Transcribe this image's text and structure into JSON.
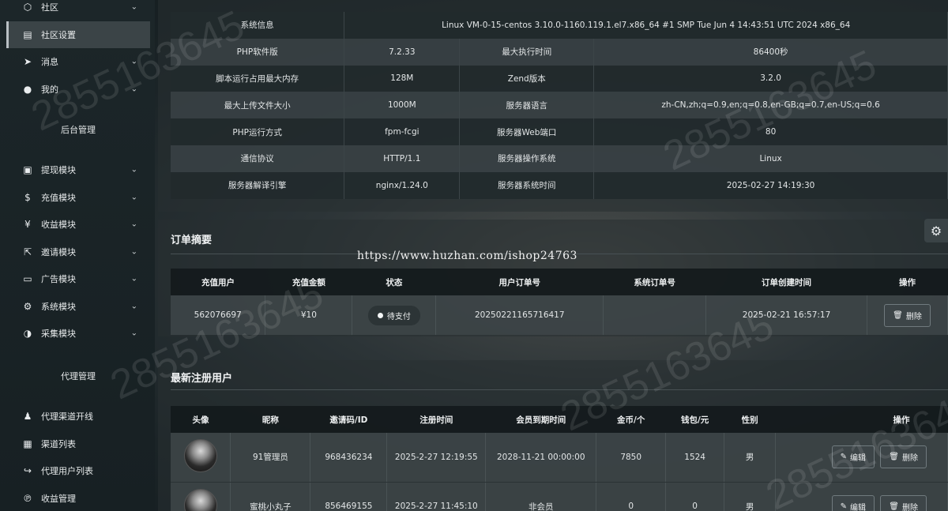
{
  "sidebar": {
    "top_items": [
      {
        "label": "社区",
        "icon": "cube-icon",
        "chevron": true
      },
      {
        "label": "社区设置",
        "icon": "document-icon",
        "chevron": false,
        "active": true
      },
      {
        "label": "消息",
        "icon": "send-icon",
        "chevron": true
      },
      {
        "label": "我的",
        "icon": "user-icon",
        "chevron": true
      }
    ],
    "section1": "后台管理",
    "admin_items": [
      {
        "label": "提现模块",
        "icon": "money-icon"
      },
      {
        "label": "充值模块",
        "icon": "dollar-icon"
      },
      {
        "label": "收益模块",
        "icon": "yen-icon"
      },
      {
        "label": "邀请模块",
        "icon": "share-icon"
      },
      {
        "label": "广告模块",
        "icon": "monitor-icon"
      },
      {
        "label": "系统模块",
        "icon": "gear-icon"
      },
      {
        "label": "采集模块",
        "icon": "half-circle-icon"
      }
    ],
    "section2": "代理管理",
    "agent_items": [
      {
        "label": "代理渠道开线",
        "icon": "person-icon"
      },
      {
        "label": "渠道列表",
        "icon": "board-icon"
      },
      {
        "label": "代理用户列表",
        "icon": "reply-icon"
      },
      {
        "label": "收益管理",
        "icon": "pinterest-icon"
      }
    ]
  },
  "system_info": {
    "row0": {
      "label": "系统信息",
      "value": "Linux VM-0-15-centos 3.10.0-1160.119.1.el7.x86_64 #1 SMP Tue Jun 4 14:43:51 UTC 2024 x86_64"
    },
    "rows": [
      [
        "PHP软件版",
        "7.2.33",
        "最大执行时间",
        "86400秒"
      ],
      [
        "脚本运行占用最大内存",
        "128M",
        "Zend版本",
        "3.2.0"
      ],
      [
        "最大上传文件大小",
        "1000M",
        "服务器语言",
        "zh-CN,zh;q=0.9,en;q=0.8,en-GB;q=0.7,en-US;q=0.6"
      ],
      [
        "PHP运行方式",
        "fpm-fcgi",
        "服务器Web端口",
        "80"
      ],
      [
        "通信协议",
        "HTTP/1.1",
        "服务器操作系统",
        "Linux"
      ],
      [
        "服务器解译引擎",
        "nginx/1.24.0",
        "服务器系统时间",
        "2025-02-27 14:19:30"
      ]
    ]
  },
  "orders": {
    "title": "订单摘要",
    "headers": [
      "充值用户",
      "充值金额",
      "状态",
      "用户订单号",
      "系统订单号",
      "订单创建时间",
      "操作"
    ],
    "row": {
      "user": "562076697",
      "amount": "¥10",
      "status": "待支付",
      "user_order": "20250221165716417",
      "sys_order": "",
      "created": "2025-02-21 16:57:17",
      "delete": "删除"
    }
  },
  "users": {
    "title": "最新注册用户",
    "headers": [
      "头像",
      "昵称",
      "邀请码/ID",
      "注册时间",
      "会员到期时间",
      "金币/个",
      "钱包/元",
      "性别",
      "操作"
    ],
    "rows": [
      {
        "nick": "91管理员",
        "code": "968436234",
        "reg": "2025-2-27 12:19:55",
        "expire": "2028-11-21 00:00:00",
        "coins": "7850",
        "wallet": "1524",
        "gender": "男",
        "edit": "编辑",
        "delete": "删除"
      },
      {
        "nick": "蜜桃小丸子",
        "code": "856469155",
        "reg": "2025-2-27 11:45:10",
        "expire": "非会员",
        "coins": "0",
        "wallet": "0",
        "gender": "男",
        "edit": "编辑",
        "delete": "删除"
      }
    ]
  },
  "overlay_url": "https://www.huzhan.com/ishop24763",
  "watermark": "2855163645"
}
